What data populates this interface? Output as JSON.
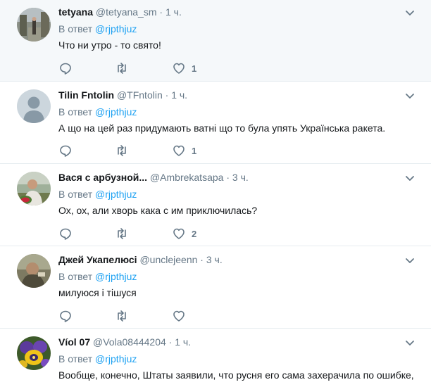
{
  "reply_prefix": "В ответ",
  "tweets": [
    {
      "name": "tetyana",
      "handle": "@tetyana_sm",
      "dot": "·",
      "time": "1 ч.",
      "reply_to": "@rjpthjuz",
      "text": "Что ни утро - то свято!",
      "likes": "1",
      "avatar": "photo-street"
    },
    {
      "name": "Tilin Fntolin",
      "handle": "@TFntolin",
      "dot": "·",
      "time": "1 ч.",
      "reply_to": "@rjpthjuz",
      "text": "А що на цей раз придумають ватні що то була упять Українська ракета.",
      "likes": "1",
      "avatar": "default-avatar"
    },
    {
      "name": "Вася с арбузной...",
      "handle": "@Ambrekatsapa",
      "dot": "·",
      "time": "3 ч.",
      "reply_to": "@rjpthjuz",
      "text": "Ох, ох, али хворь кака с им приключилась?",
      "likes": "2",
      "avatar": "photo-man"
    },
    {
      "name": "Джей Укапелюсі",
      "handle": "@unclejeenn",
      "dot": "·",
      "time": "3 ч.",
      "reply_to": "@rjpthjuz",
      "text": "милуюся і тішуся",
      "likes": "",
      "avatar": "photo-painting"
    },
    {
      "name": "Víol 07",
      "handle": "@Vola08444204",
      "dot": "·",
      "time": "1 ч.",
      "reply_to": "@rjpthjuz",
      "text": "Вообще, конечно, Штаты заявили, что русня его сама захерачила по ошибке,",
      "likes": "",
      "avatar": "photo-pansy"
    }
  ],
  "colors": {
    "link": "#1da1f2",
    "muted": "#657786",
    "divider": "#e6ecf0",
    "highlight_bg": "#f5f8fa"
  },
  "icons": {
    "reply": "reply-icon",
    "retweet": "retweet-icon",
    "like": "heart-icon",
    "more": "chevron-down-icon"
  }
}
